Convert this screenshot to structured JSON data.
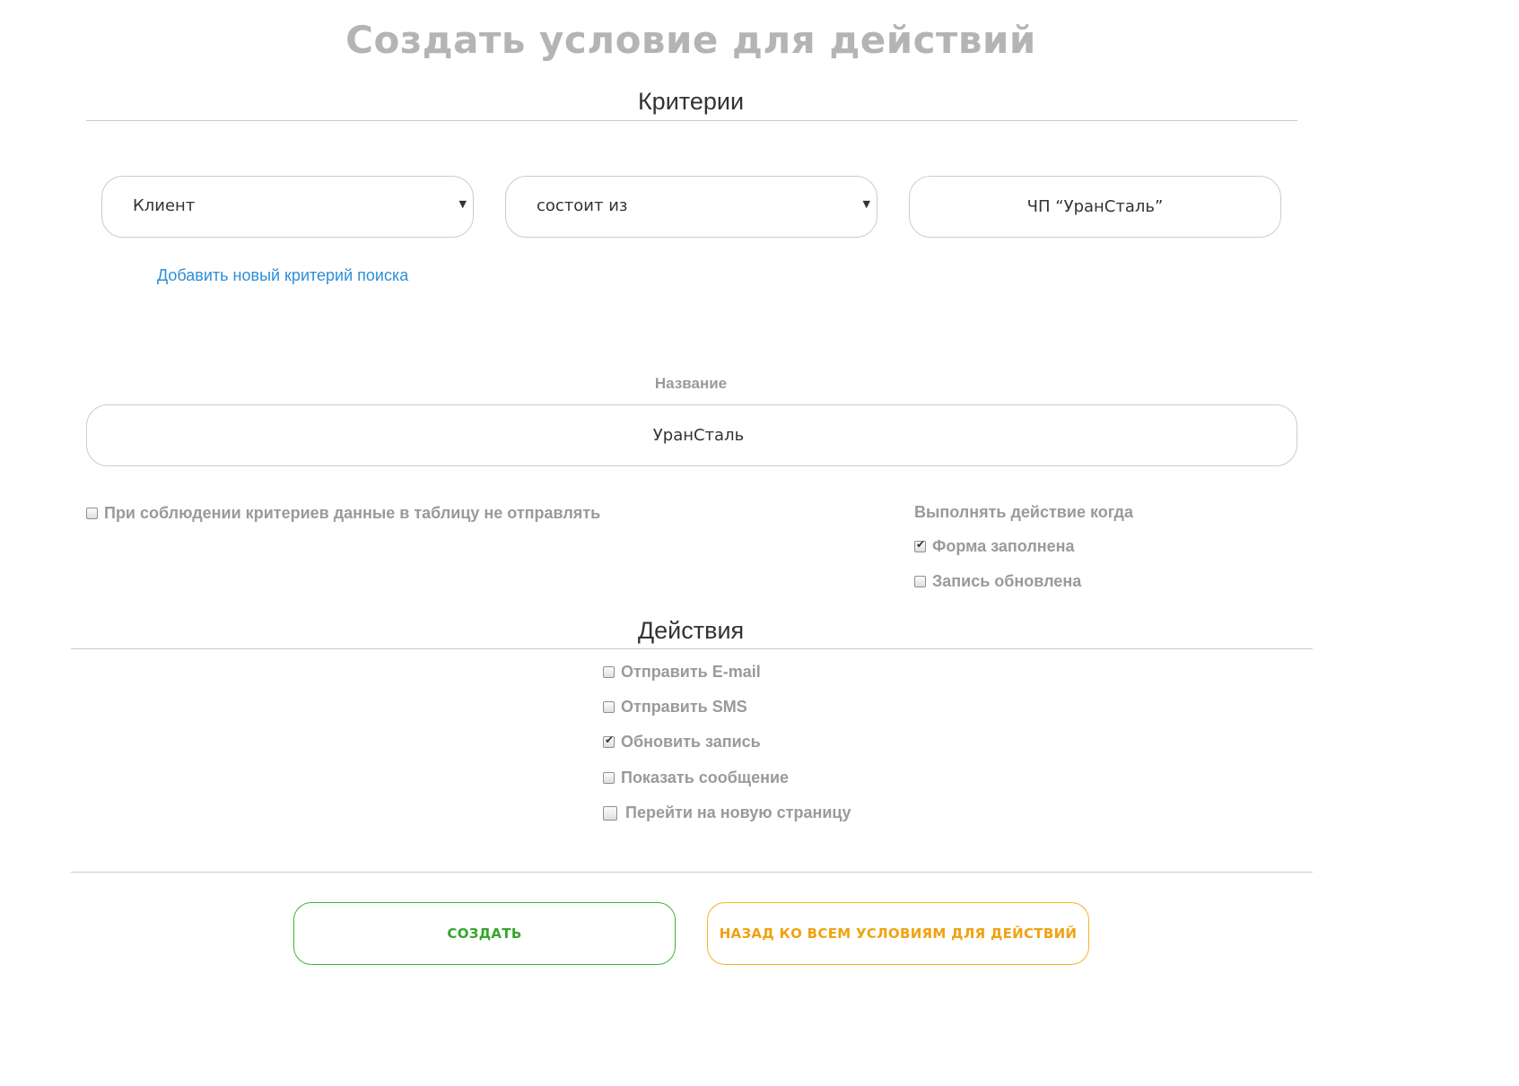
{
  "header": {
    "title": "Создать условие для действий"
  },
  "criteria": {
    "section_title": "Критерии",
    "field_select": "Клиент",
    "operator_select": "состоит из",
    "value_input": "ЧП “УранСталь”",
    "add_link": "Добавить новый критерий поиска"
  },
  "name_field": {
    "label": "Название",
    "value": "УранСталь"
  },
  "options": {
    "no_send": {
      "label": "При соблюдении критериев данные в таблицу не отправлять",
      "checked": false
    },
    "trigger_heading": "Выполнять действие когда",
    "triggers": [
      {
        "label": "Форма заполнена",
        "checked": true
      },
      {
        "label": "Запись обновлена",
        "checked": false
      }
    ]
  },
  "actions": {
    "section_title": "Действия",
    "items": [
      {
        "label": "Отправить E-mail",
        "checked": false
      },
      {
        "label": "Отправить SMS",
        "checked": false
      },
      {
        "label": "Обновить запись",
        "checked": true
      },
      {
        "label": "Показать сообщение",
        "checked": false
      },
      {
        "label": "Перейти на новую страницу",
        "checked": false
      }
    ]
  },
  "buttons": {
    "create": "СОЗДАТЬ",
    "back": "НАЗАД КО ВСЕМ УСЛОВИЯМ ДЛЯ ДЕЙСТВИЙ"
  }
}
